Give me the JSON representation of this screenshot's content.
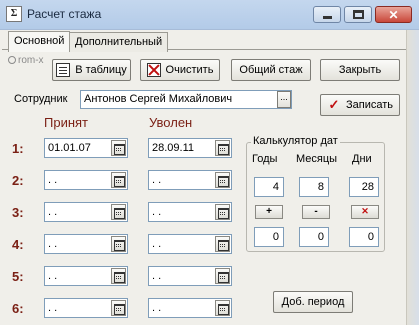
{
  "window": {
    "title": "Расчет стажа"
  },
  "tabs": [
    {
      "label": "Основной"
    },
    {
      "label": "Дополнительный"
    }
  ],
  "watermark": "rom-x",
  "toolbar": {
    "to_table": "В таблицу",
    "clear": "Очистить",
    "total": "Общий стаж",
    "close": "Закрыть"
  },
  "employee": {
    "label": "Сотрудник",
    "value": "Антонов Сергей Михайлович",
    "browse": "..."
  },
  "save_label": "Записать",
  "columns": {
    "hired": "Принят",
    "fired": "Уволен"
  },
  "periods": [
    {
      "num": "1:",
      "hired": "01.01.07",
      "fired": "28.09.11"
    },
    {
      "num": "2:",
      "hired": " . .",
      "fired": " . ."
    },
    {
      "num": "3:",
      "hired": " . .",
      "fired": " . ."
    },
    {
      "num": "4:",
      "hired": " . .",
      "fired": " . ."
    },
    {
      "num": "5:",
      "hired": " . .",
      "fired": " . ."
    },
    {
      "num": "6:",
      "hired": " . .",
      "fired": " . ."
    }
  ],
  "calculator": {
    "title": "Калькулятор дат",
    "headers": {
      "years": "Годы",
      "months": "Месяцы",
      "days": "Дни"
    },
    "values": {
      "years": "4",
      "months": "8",
      "days": "28"
    },
    "ops": {
      "add": "+",
      "sub": "-"
    },
    "results": {
      "years": "0",
      "months": "0",
      "days": "0"
    }
  },
  "add_period": "Доб. период",
  "colors": {
    "accent": "#7a1f14",
    "titlebar": "#b8cde9"
  }
}
